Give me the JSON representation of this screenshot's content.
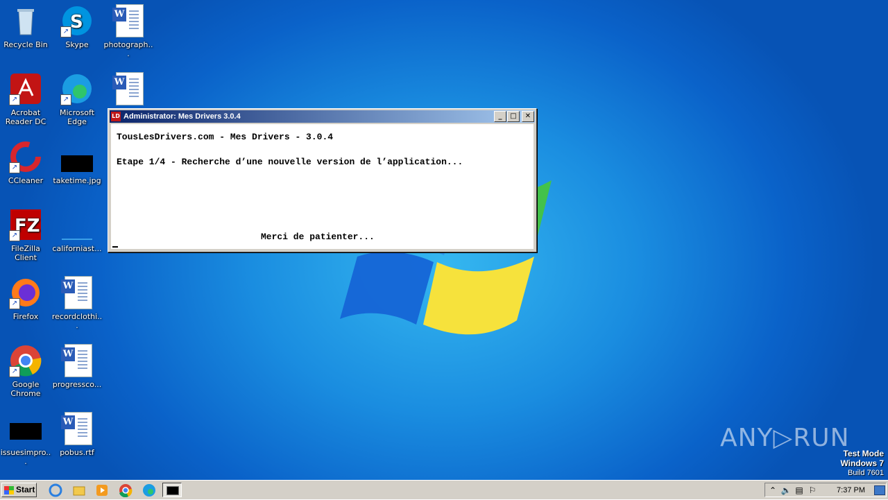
{
  "desktop": {
    "icons": [
      {
        "label": "Recycle Bin"
      },
      {
        "label": "Skype"
      },
      {
        "label": "photograph..."
      },
      {
        "label": "Acrobat Reader DC"
      },
      {
        "label": "Microsoft Edge"
      },
      {
        "label": "CCleaner"
      },
      {
        "label": "taketime.jpg"
      },
      {
        "label": "FileZilla Client"
      },
      {
        "label": "californiast..."
      },
      {
        "label": "Firefox"
      },
      {
        "label": "recordclothi..."
      },
      {
        "label": "Google Chrome"
      },
      {
        "label": "progressco..."
      },
      {
        "label": "issuesimpro..."
      },
      {
        "label": "pobus.rtf"
      }
    ]
  },
  "window": {
    "title": "Administrator:  Mes Drivers 3.0.4",
    "console_lines": [
      "TousLesDrivers.com - Mes Drivers - 3.0.4",
      "Etape 1/4 - Recherche d’une nouvelle version de l’application...",
      "Merci de patienter..."
    ],
    "buttons": {
      "minimize": "_",
      "maximize": "□",
      "close": "✕"
    }
  },
  "watermark": {
    "brand": "ANY▷RUN",
    "line1": "Test Mode",
    "line2": "Windows 7",
    "line3": "Build 7601"
  },
  "taskbar": {
    "start_label": "Start",
    "clock": "7:37 PM",
    "pinned": [
      "internet-explorer-icon",
      "file-explorer-icon",
      "media-player-icon",
      "chrome-icon",
      "edge-icon",
      "cmd-icon"
    ]
  }
}
